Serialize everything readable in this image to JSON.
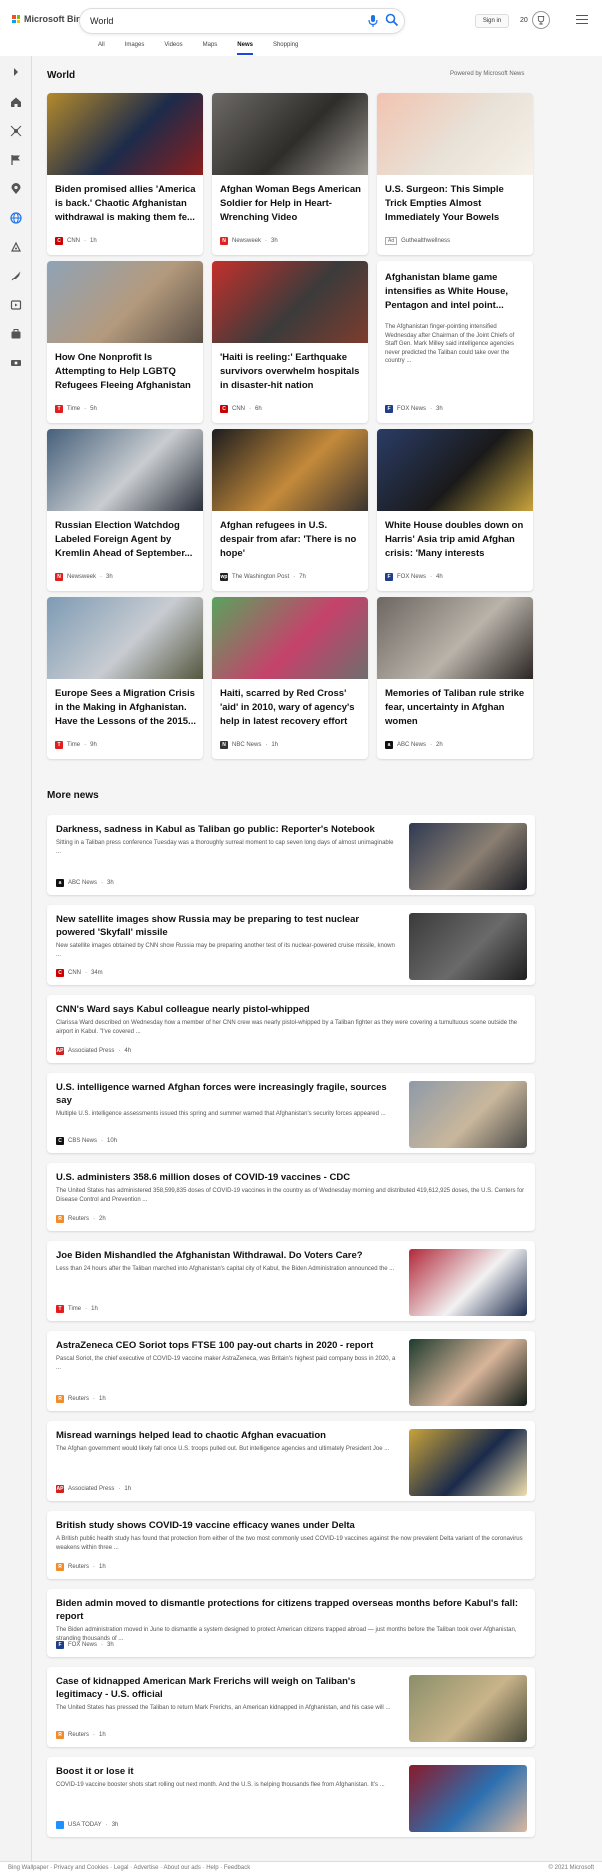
{
  "header": {
    "logo_text": "Microsoft Bing",
    "search_value": "World",
    "signin_label": "Sign in",
    "points": "20",
    "tabs": [
      "All",
      "Images",
      "Videos",
      "Maps",
      "News",
      "Shopping"
    ],
    "active_tab": "News"
  },
  "world": {
    "title": "World",
    "powered_by": "Powered by Microsoft News",
    "cards": [
      {
        "title": "Biden promised allies 'America is back.' Chaotic Afghanistan withdrawal is making them fe...",
        "source": "CNN",
        "time": "1h",
        "logo_color": "#cc0000",
        "logo_char": "C",
        "img_colors": [
          "#b48a2c",
          "#1d2b4a",
          "#8a1f1f"
        ]
      },
      {
        "title": "Afghan Woman Begs American Soldier for Help in Heart-Wrenching Video",
        "source": "Newsweek",
        "time": "3h",
        "logo_color": "#e0201f",
        "logo_char": "N",
        "img_colors": [
          "#6d6a66",
          "#2f2d2a",
          "#9a9690"
        ]
      },
      {
        "title": "U.S. Surgeon: This Simple Trick Empties Almost Immediately Your Bowels Every Morning",
        "source": "Guthealthwellness",
        "time": "",
        "ad": "Ad",
        "logo_color": "",
        "logo_char": "",
        "img_colors": [
          "#f2c3b0",
          "#e8e2d8",
          "#f6f1e9"
        ]
      },
      {
        "title": "How One Nonprofit Is Attempting to Help LGBTQ Refugees Fleeing Afghanistan",
        "source": "Time",
        "time": "5h",
        "logo_color": "#e31d1d",
        "logo_char": "T",
        "img_colors": [
          "#8fa3b7",
          "#b49a7d",
          "#5b5046"
        ]
      },
      {
        "title": "'Haiti is reeling:' Earthquake survivors overwhelm hospitals in disaster-hit nation",
        "source": "CNN",
        "time": "6h",
        "logo_color": "#cc0000",
        "logo_char": "C",
        "img_colors": [
          "#c4302b",
          "#3b3b3b",
          "#7d3c2e"
        ]
      },
      {
        "title": "Afghanistan blame game intensifies as White House, Pentagon and intel point...",
        "snippet": "The Afghanistan finger-pointing intensified Wednesday after Chairman of the Joint Chiefs of Staff Gen. Mark Milley said intelligence agencies never predicted the Taliban could take over the country ...",
        "source": "FOX News",
        "time": "3h",
        "logo_color": "#1f3f8a",
        "logo_char": "F"
      },
      {
        "title": "Russian Election Watchdog Labeled Foreign Agent by Kremlin Ahead of September...",
        "source": "Newsweek",
        "time": "3h",
        "logo_color": "#e0201f",
        "logo_char": "N",
        "img_colors": [
          "#46607a",
          "#c9cdd1",
          "#2a2f3a"
        ]
      },
      {
        "title": "Afghan refugees in U.S. despair from afar: 'There is no hope'",
        "source": "The Washington Post",
        "time": "7h",
        "logo_color": "#222222",
        "logo_char": "wp",
        "img_colors": [
          "#1d1d1f",
          "#c48a3a",
          "#3a3430"
        ]
      },
      {
        "title": "White House doubles down on Harris' Asia trip amid Afghan crisis: 'Many interests around...",
        "source": "FOX News",
        "time": "4h",
        "logo_color": "#1f3f8a",
        "logo_char": "F",
        "img_colors": [
          "#2a3c66",
          "#1a1a1a",
          "#c9a43c"
        ]
      },
      {
        "title": "Europe Sees a Migration Crisis in the Making in Afghanistan. Have the Lessons of the 2015...",
        "source": "Time",
        "time": "9h",
        "logo_color": "#e31d1d",
        "logo_char": "T",
        "img_colors": [
          "#7e9bb4",
          "#c8ccd2",
          "#55573f"
        ]
      },
      {
        "title": "Haiti, scarred by Red Cross' 'aid' in 2010, wary of agency's help in latest recovery effort",
        "source": "NBC News",
        "time": "1h",
        "logo_color": "#333333",
        "logo_char": "N",
        "img_colors": [
          "#5aa35e",
          "#c5426b",
          "#6e6e6e"
        ]
      },
      {
        "title": "Memories of Taliban rule strike fear, uncertainty in Afghan women",
        "source": "ABC News",
        "time": "2h",
        "logo_color": "#111111",
        "logo_char": "a",
        "img_colors": [
          "#6d6661",
          "#b9b3aa",
          "#2b2624"
        ]
      }
    ]
  },
  "more_news": {
    "title": "More news",
    "items": [
      {
        "title": "Darkness, sadness in Kabul as Taliban go public: Reporter's Notebook",
        "snippet": "Sitting in a Taliban press conference Tuesday was a thoroughly surreal moment to cap seven long days of almost unimaginable ...",
        "source": "ABC News",
        "time": "3h",
        "logo_color": "#111111",
        "logo_char": "a",
        "img_colors": [
          "#2f3a52",
          "#8a7f72",
          "#1a1c24"
        ]
      },
      {
        "title": "New satellite images show Russia may be preparing to test nuclear powered 'Skyfall' missile",
        "snippet": "New satellite images obtained by CNN show Russia may be preparing another test of its nuclear-powered cruise missile, known ...",
        "source": "CNN",
        "time": "34m",
        "logo_color": "#cc0000",
        "logo_char": "C",
        "img_colors": [
          "#3a3a3a",
          "#6a6a6a",
          "#1e1e1e"
        ]
      },
      {
        "title": "CNN's Ward says Kabul colleague nearly pistol-whipped",
        "snippet": "Clarissa Ward described on Wednesday how a member of her CNN crew was nearly pistol-whipped by a Taliban fighter as they were covering a tumultuous scene outside the airport in Kabul. \"I've covered ...",
        "source": "Associated Press",
        "time": "4h",
        "logo_color": "#d22020",
        "logo_char": "AP"
      },
      {
        "title": "U.S. intelligence warned Afghan forces were increasingly fragile, sources say",
        "snippet": "Multiple U.S. intelligence assessments issued this spring and summer warned that Afghanistan's security forces appeared ...",
        "source": "CBS News",
        "time": "10h",
        "logo_color": "#111111",
        "logo_char": "C",
        "img_colors": [
          "#8e9aa8",
          "#c9b79c",
          "#4b4a48"
        ]
      },
      {
        "title": "U.S. administers 358.6 million doses of COVID-19 vaccines - CDC",
        "snippet": "The United States has administered 358,599,835 doses of COVID-19 vaccines in the country as of Wednesday morning and distributed 419,612,925 doses, the U.S. Centers for Disease Control and Prevention ...",
        "source": "Reuters",
        "time": "2h",
        "logo_color": "#f28c28",
        "logo_char": "R"
      },
      {
        "title": "Joe Biden Mishandled the Afghanistan Withdrawal. Do Voters Care?",
        "snippet": "Less than 24 hours after the Taliban marched into Afghanistan's capital city of Kabul, the Biden Administration announced the ...",
        "source": "Time",
        "time": "1h",
        "logo_color": "#e31d1d",
        "logo_char": "T",
        "img_colors": [
          "#b2283a",
          "#f2f2f2",
          "#1c2a4d"
        ]
      },
      {
        "title": "AstraZeneca CEO Soriot tops FTSE 100 pay-out charts in 2020 - report",
        "snippet": "Pascal Soriot, the chief executive of COVID-19 vaccine maker AstraZeneca, was Britain's highest paid company boss in 2020, a ...",
        "source": "Reuters",
        "time": "1h",
        "logo_color": "#f28c28",
        "logo_char": "R",
        "img_colors": [
          "#1e3b2e",
          "#d8b59a",
          "#0f1a16"
        ]
      },
      {
        "title": "Misread warnings helped lead to chaotic Afghan evacuation",
        "snippet": "The Afghan government would likely fall once U.S. troops pulled out. But intelligence agencies and ultimately President Joe ...",
        "source": "Associated Press",
        "time": "1h",
        "logo_color": "#d22020",
        "logo_char": "AP",
        "img_colors": [
          "#c9a33a",
          "#1a2a4a",
          "#f0e0b0"
        ]
      },
      {
        "title": "British study shows COVID-19 vaccine efficacy wanes under Delta",
        "snippet": "A British public health study has found that protection from either of the two most commonly used COVID-19 vaccines against the now prevalent Delta variant of the coronavirus weakens within three ...",
        "source": "Reuters",
        "time": "1h",
        "logo_color": "#f28c28",
        "logo_char": "R"
      },
      {
        "title": "Biden admin moved to dismantle protections for citizens trapped overseas months before Kabul's fall: report",
        "snippet": "The Biden administration moved in June to dismantle a system designed to protect American citizens trapped abroad — just months before the Taliban took over Afghanistan, stranding thousands of ...",
        "source": "FOX News",
        "time": "3h",
        "logo_color": "#1f3f8a",
        "logo_char": "F"
      },
      {
        "title": "Case of kidnapped American Mark Frerichs will weigh on Taliban's legitimacy - U.S. official",
        "snippet": "The United States has pressed the Taliban to return Mark Frerichs, an American kidnapped in Afghanistan, and his case will ...",
        "source": "Reuters",
        "time": "1h",
        "logo_color": "#f28c28",
        "logo_char": "R",
        "img_colors": [
          "#8a8f6a",
          "#c9b48a",
          "#4a4a38"
        ]
      },
      {
        "title": "Boost it or lose it",
        "snippet": "COVID-19 vaccine booster shots start rolling out next month. And the U.S. is helping thousands flee from Afghanistan. It's ...",
        "source": "USA TODAY",
        "time": "3h",
        "logo_color": "#1e90ff",
        "logo_char": "",
        "img_colors": [
          "#8a1a2a",
          "#2c6fb0",
          "#d9b8a0"
        ]
      }
    ]
  },
  "footer": {
    "left": "Bing Wallpaper · Privacy and Cookies · Legal · Advertise · About our ads · Help · Feedback",
    "right": "© 2021 Microsoft"
  }
}
